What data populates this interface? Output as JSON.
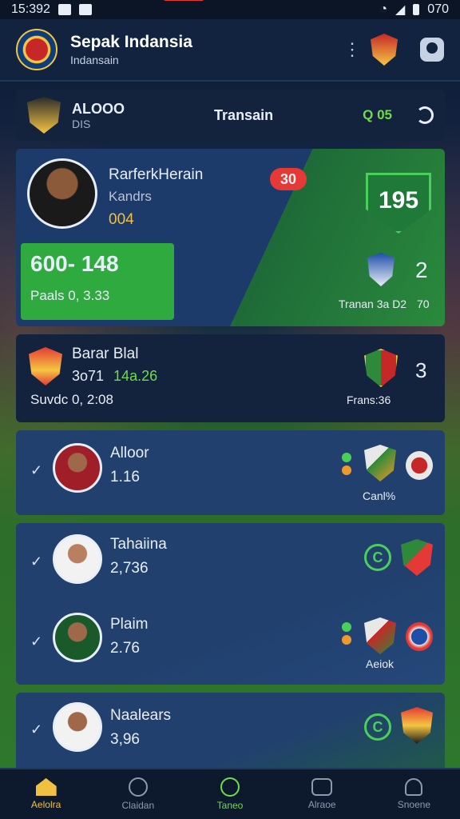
{
  "status_bar": {
    "time": "15:392",
    "battery": "070"
  },
  "header": {
    "title": "Sepak Indansia",
    "subtitle": "Indansain"
  },
  "match_bar": {
    "team_name": "ALOOO",
    "team_sub": "DIS",
    "center_label": "Transain",
    "score": "Q 05"
  },
  "featured": {
    "name": "RarferkHerain",
    "club": "Kandrs",
    "number": "004",
    "badge": "30",
    "rating": "195",
    "stat_main": "600-   148",
    "stat_sub": "Paals  0, 3.33",
    "extra_num": "2",
    "transfer_label": "Tranan 3a D2",
    "transfer_value": "70"
  },
  "mid_card": {
    "name": "Barar Blal",
    "line_left": "3o71",
    "line_right": "14a.26",
    "sub": "Suvdc  0, 2:08",
    "right_num": "3",
    "transfer_label": "Frans:36"
  },
  "players": [
    {
      "name": "Alloor",
      "value": "1.16",
      "crest_label": "Canl%"
    },
    {
      "name": "Tahaiina",
      "value": "2,736",
      "ring": "C"
    },
    {
      "name": "Plaim",
      "value": "2.76",
      "crest_label": "Aeiok"
    },
    {
      "name": "Naalears",
      "value": "3,96",
      "ring": "C"
    }
  ],
  "bottom_nav": [
    {
      "label": "Aelolra"
    },
    {
      "label": "Claidan"
    },
    {
      "label": "Taneo"
    },
    {
      "label": "Alraoe"
    },
    {
      "label": "Snoene"
    }
  ],
  "colors": {
    "accent_green": "#4ad05a",
    "accent_gold": "#f0c040",
    "badge_red": "#e53935",
    "card_bg": "#21406e"
  }
}
